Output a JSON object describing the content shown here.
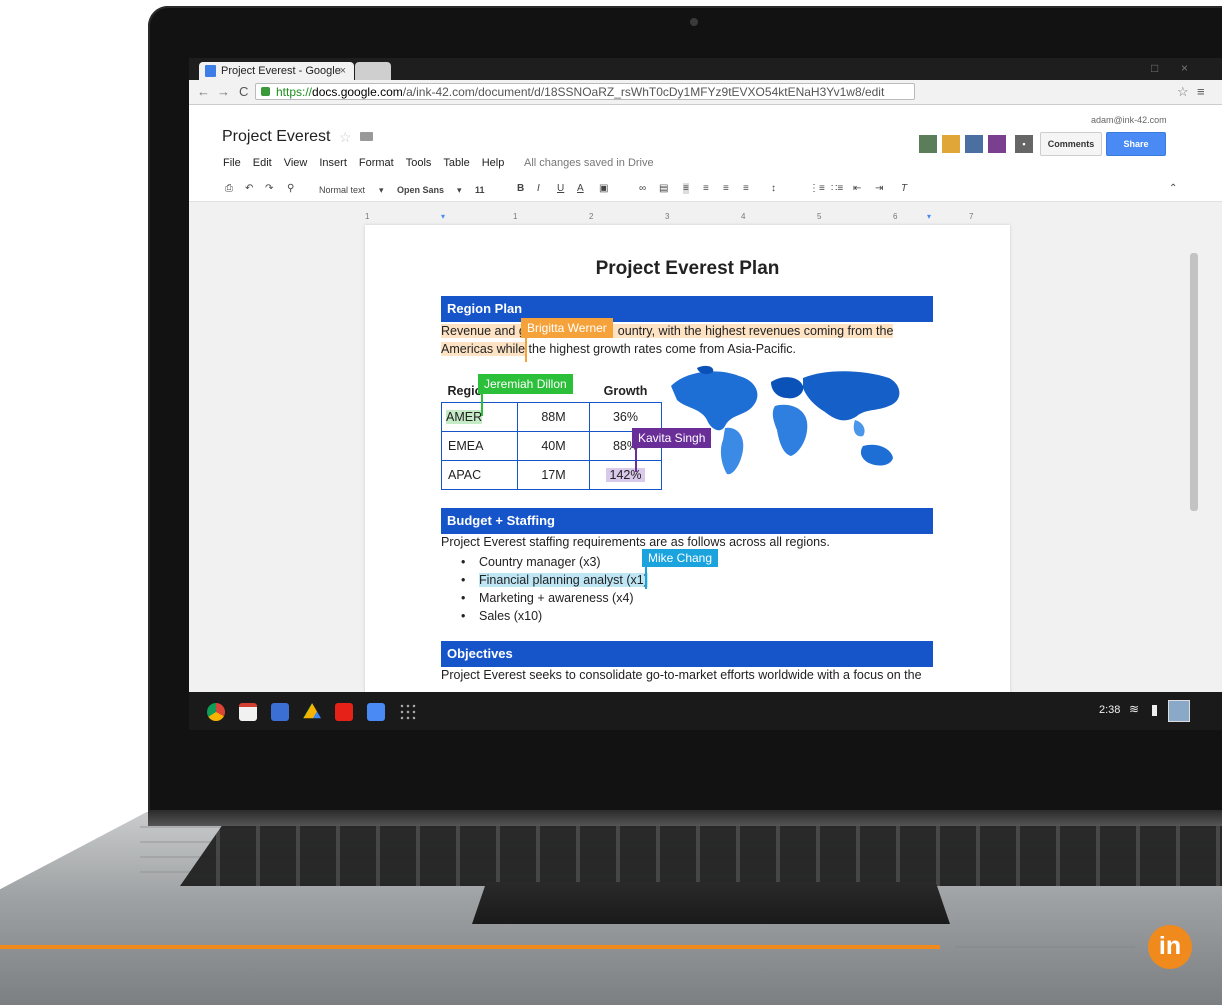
{
  "browser": {
    "tab_title": "Project Everest - Google",
    "tab_close": "×",
    "url_scheme": "https://",
    "url_host": "docs.google.com",
    "url_path": "/a/ink-42.com/document/d/18SSNOaRZ_rsWhT0cDy1MFYz9tEVXO54ktENaH3Yv1w8/edit",
    "star_glyph": "☆",
    "menu_glyph": "≡"
  },
  "docs": {
    "title": "Project Everest",
    "menu": [
      "File",
      "Edit",
      "View",
      "Insert",
      "Format",
      "Tools",
      "Table",
      "Help"
    ],
    "save_status": "All changes saved in Drive",
    "user_email": "adam@ink-42.com",
    "comments_label": "Comments",
    "share_label": "Share",
    "toolbar": {
      "style": "Normal text",
      "font": "Open Sans",
      "size": "11",
      "bold": "B",
      "italic": "I",
      "underline": "U",
      "text_color": "A"
    },
    "ruler": [
      "1",
      "1",
      "2",
      "3",
      "4",
      "5",
      "6",
      "7"
    ]
  },
  "document": {
    "heading": "Project Everest Plan",
    "sections": {
      "region": {
        "title": "Region Plan",
        "line1_a": "Revenue and g",
        "line1_b": "ountry, with the highest revenues coming from the",
        "line2_a": "Americas while",
        "line2_b": " the highest growth rates come from Asia-Pacific.",
        "table": {
          "headers": [
            "Regio",
            "",
            "Growth"
          ],
          "rows": [
            [
              "AMER",
              "88M",
              "36%"
            ],
            [
              "EMEA",
              "40M",
              "88%"
            ],
            [
              "APAC",
              "17M",
              "142%"
            ]
          ]
        }
      },
      "budget": {
        "title": "Budget + Staffing",
        "intro": "Project Everest staffing requirements are as follows across all regions.",
        "items": [
          "Country manager (x3)",
          "Financial planning analyst (x1)",
          "Marketing + awareness (x4)",
          "Sales (x10)"
        ]
      },
      "objectives": {
        "title": "Objectives",
        "text": "Project Everest seeks to consolidate go-to-market efforts worldwide with a focus on the"
      }
    },
    "collaborators": [
      {
        "name": "Brigitta Werner",
        "color": "#f6a23a"
      },
      {
        "name": "Jeremiah Dillon",
        "color": "#2bbf3a"
      },
      {
        "name": "Kavita Singh",
        "color": "#6a2e98"
      },
      {
        "name": "Mike Chang",
        "color": "#1aa3dd"
      }
    ]
  },
  "shelf": {
    "time": "2:38",
    "wifi_glyph": "≋"
  },
  "branding": {
    "logo_text": "in"
  }
}
